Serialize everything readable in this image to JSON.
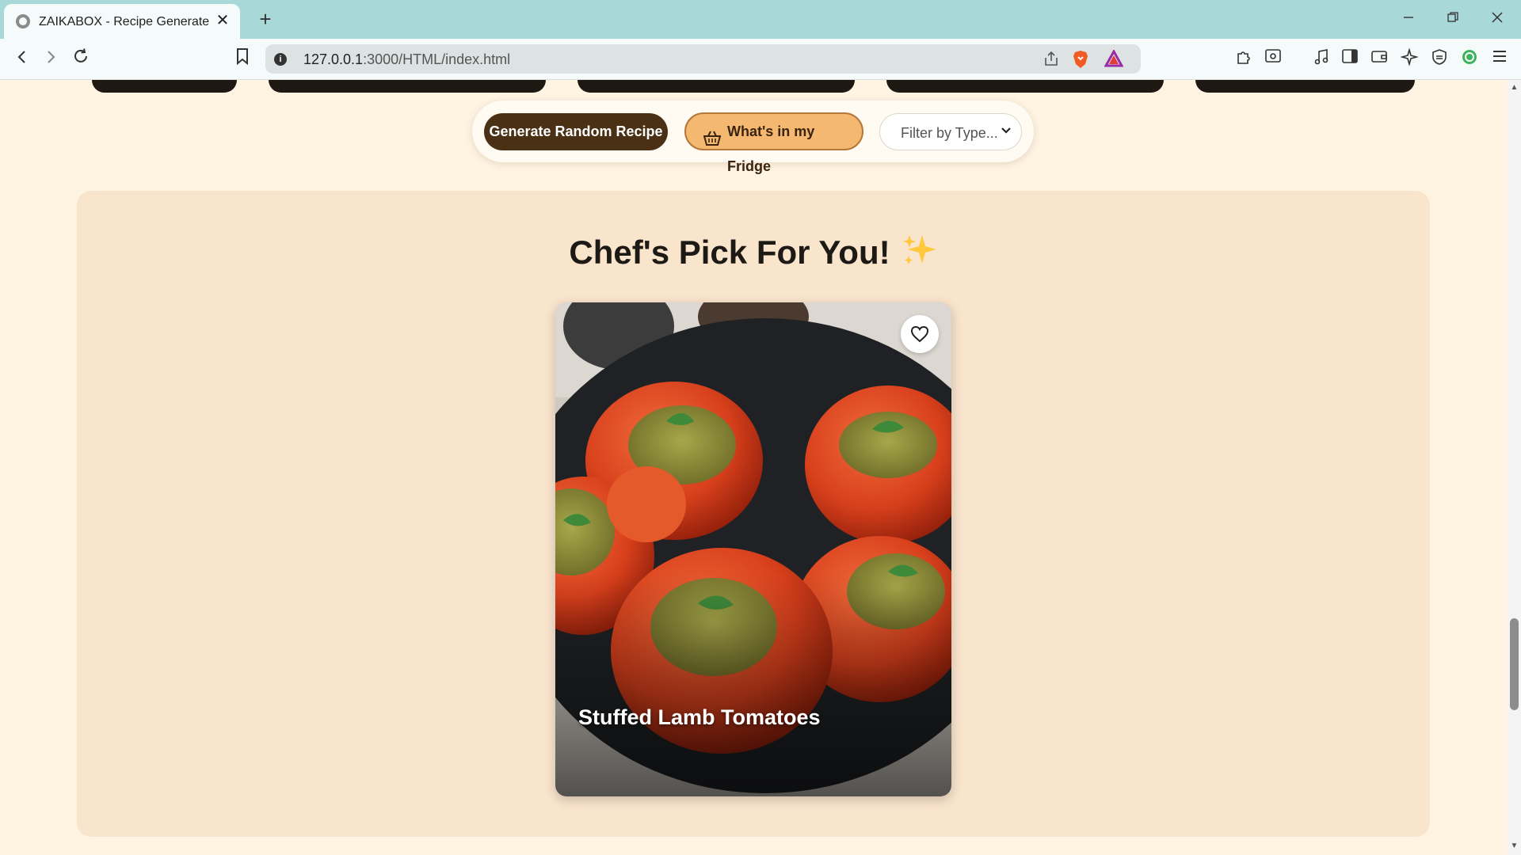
{
  "browser": {
    "tab_title": "ZAIKABOX - Recipe Generate",
    "tab_close": "✕",
    "new_tab": "+",
    "url_host": "127.0.0.1",
    "url_path": ":3000/HTML/index.html"
  },
  "controls": {
    "random_label": "Generate Random Recipe",
    "fridge_label": "What's in my Fridge",
    "filter_placeholder": "Filter by Type..."
  },
  "section": {
    "title": "Chef's Pick For You!"
  },
  "card": {
    "title": "Stuffed Lamb Tomatoes"
  },
  "colors": {
    "page_bg": "#fff3e2",
    "section_bg": "#f9e4cc",
    "primary_button": "#4a3115",
    "secondary_button": "#f4b870",
    "browser_tabbar": "#a8d8d8"
  },
  "icons": [
    "back-icon",
    "forward-icon",
    "reload-icon",
    "bookmark-icon",
    "info-icon",
    "share-icon",
    "brave-shield-icon",
    "rewards-icon",
    "extensions-icon",
    "music-icon",
    "sidebar-icon",
    "wallet-icon",
    "leo-icon",
    "vpn-icon",
    "menu-icon",
    "basket-icon",
    "sparkle-icon",
    "heart-icon"
  ]
}
